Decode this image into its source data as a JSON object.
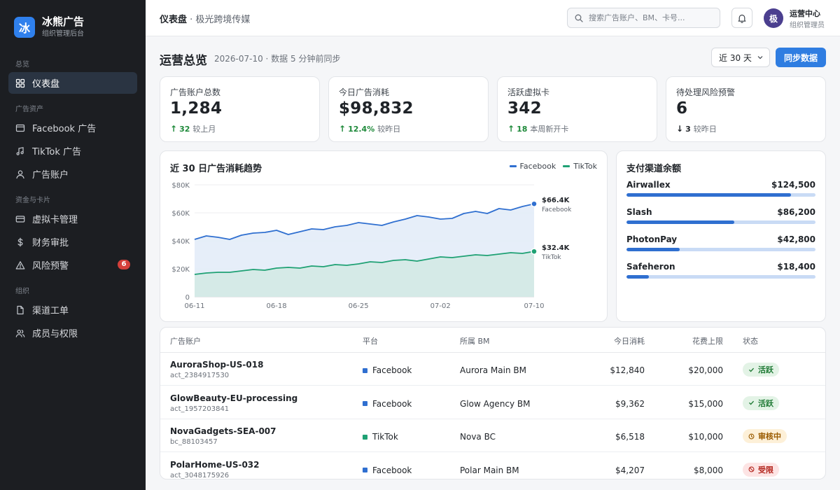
{
  "brand": {
    "logo_char": "冰",
    "name": "冰熊广告",
    "subtitle": "组织管理后台"
  },
  "sidebar": {
    "groups": [
      {
        "label": "总览",
        "items": [
          {
            "label": "仪表盘",
            "icon": "grid-icon",
            "active": true
          }
        ]
      },
      {
        "label": "广告资产",
        "items": [
          {
            "label": "Facebook 广告",
            "icon": "browser-window-icon"
          },
          {
            "label": "TikTok 广告",
            "icon": "music-note-icon"
          },
          {
            "label": "广告账户",
            "icon": "user-icon"
          }
        ]
      },
      {
        "label": "资金与卡片",
        "items": [
          {
            "label": "虚拟卡管理",
            "icon": "credit-card-icon"
          },
          {
            "label": "财务审批",
            "icon": "dollar-icon"
          },
          {
            "label": "风险预警",
            "icon": "warning-triangle-icon",
            "badge": "6"
          }
        ]
      },
      {
        "label": "组织",
        "items": [
          {
            "label": "渠道工单",
            "icon": "document-icon"
          },
          {
            "label": "成员与权限",
            "icon": "users-icon"
          }
        ]
      }
    ]
  },
  "topbar": {
    "breadcrumb_current": "仪表盘",
    "breadcrumb_org": " · 极光跨境传媒",
    "search_placeholder": "搜索广告账户、BM、卡号...",
    "user_initial": "极",
    "user_name": "运营中心",
    "user_role": "组织管理员"
  },
  "header": {
    "title": "运营总览",
    "subtitle": "2026-07-10 · 数据 5 分钟前同步",
    "range": "近 30 天",
    "sync_label": "同步数据"
  },
  "kpis": [
    {
      "label": "广告账户总数",
      "value": "1,284",
      "direction": "up",
      "arrow": "↑",
      "delta": "32",
      "note": "较上月"
    },
    {
      "label": "今日广告消耗",
      "value": "$98,832",
      "direction": "up",
      "arrow": "↑",
      "delta": "12.4%",
      "note": "较昨日"
    },
    {
      "label": "活跃虚拟卡",
      "value": "342",
      "direction": "up",
      "arrow": "↑",
      "delta": "18",
      "note": "本周新开卡"
    },
    {
      "label": "待处理风险预警",
      "value": "6",
      "direction": "down",
      "arrow": "↓",
      "delta": "3",
      "note": "较昨日"
    }
  ],
  "chart_data": {
    "type": "area",
    "title": "近 30 日广告消耗趋势",
    "xlabel": "",
    "ylabel": "",
    "x_ticks": [
      "06-11",
      "06-18",
      "06-25",
      "07-02",
      "07-10"
    ],
    "y_ticks": [
      "0",
      "$20K",
      "$40K",
      "$60K",
      "$80K"
    ],
    "ylim": [
      0,
      80000
    ],
    "grid": true,
    "legend_position": "top-right",
    "x": [
      "06-11",
      "06-12",
      "06-13",
      "06-14",
      "06-15",
      "06-16",
      "06-17",
      "06-18",
      "06-19",
      "06-20",
      "06-21",
      "06-22",
      "06-23",
      "06-24",
      "06-25",
      "06-26",
      "06-27",
      "06-28",
      "06-29",
      "06-30",
      "07-01",
      "07-02",
      "07-03",
      "07-04",
      "07-05",
      "07-06",
      "07-07",
      "07-08",
      "07-09",
      "07-10"
    ],
    "series": [
      {
        "name": "Facebook",
        "color": "#2f6fd0",
        "fill": "#e3ecf8",
        "end_label": "$66.4K",
        "values": [
          41000,
          43500,
          42500,
          41000,
          44000,
          45500,
          46000,
          47500,
          44500,
          46500,
          48500,
          48000,
          50000,
          51000,
          53000,
          52000,
          51000,
          53500,
          55500,
          58000,
          57000,
          55500,
          56000,
          59500,
          61000,
          59500,
          63000,
          62000,
          64500,
          66400
        ]
      },
      {
        "name": "TikTok",
        "color": "#1fa174",
        "fill": "#d3e9e4",
        "end_label": "$32.4K",
        "values": [
          16000,
          17000,
          17500,
          17500,
          18500,
          19500,
          19000,
          20500,
          21000,
          20500,
          22000,
          21500,
          23000,
          22500,
          23500,
          25000,
          24500,
          26000,
          26500,
          25500,
          27000,
          28500,
          28000,
          29000,
          30000,
          29500,
          30500,
          31500,
          31000,
          32400
        ]
      }
    ]
  },
  "balances": {
    "title": "支付渠道余额",
    "items": [
      {
        "name": "Airwallex",
        "amount": "$124,500",
        "level": 0.87
      },
      {
        "name": "Slash",
        "amount": "$86,200",
        "level": 0.57
      },
      {
        "name": "PhotonPay",
        "amount": "$42,800",
        "level": 0.28
      },
      {
        "name": "Safeheron",
        "amount": "$18,400",
        "level": 0.12
      }
    ]
  },
  "table": {
    "headers": {
      "account": "广告账户",
      "platform": "平台",
      "bm": "所属 BM",
      "spend": "今日消耗",
      "limit": "花费上限",
      "status": "状态"
    },
    "rows": [
      {
        "name": "AuroraShop-US-018",
        "id": "act_2384917530",
        "platform": "Facebook",
        "platform_color": "#2f6fd0",
        "bm": "Aurora Main BM",
        "spend": "$12,840",
        "limit": "$20,000",
        "status": "活跃",
        "status_type": "active"
      },
      {
        "name": "GlowBeauty-EU-processing",
        "id": "act_1957203841",
        "platform": "Facebook",
        "platform_color": "#2f6fd0",
        "bm": "Glow Agency BM",
        "spend": "$9,362",
        "limit": "$15,000",
        "status": "活跃",
        "status_type": "active"
      },
      {
        "name": "NovaGadgets-SEA-007",
        "id": "bc_88103457",
        "platform": "TikTok",
        "platform_color": "#1fa174",
        "bm": "Nova BC",
        "spend": "$6,518",
        "limit": "$10,000",
        "status": "审核中",
        "status_type": "review"
      },
      {
        "name": "PolarHome-US-032",
        "id": "act_3048175926",
        "platform": "Facebook",
        "platform_color": "#2f6fd0",
        "bm": "Polar Main BM",
        "spend": "$4,207",
        "limit": "$8,000",
        "status": "受限",
        "status_type": "limited"
      }
    ]
  }
}
